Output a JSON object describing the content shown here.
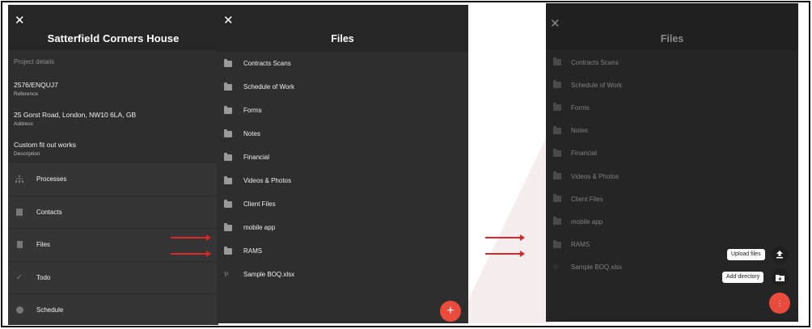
{
  "panel1": {
    "title": "Satterfield Corners House",
    "section_label": "Project details",
    "details": [
      {
        "value": "2576/ENQUJ7",
        "key": "Reference"
      },
      {
        "value": "25 Gorst Road, London, NW10 6LA, GB",
        "key": "Address"
      },
      {
        "value": "Custom fit out works",
        "key": "Description"
      }
    ],
    "menu": [
      {
        "label": "Processes",
        "icon": "sitemap-icon"
      },
      {
        "label": "Contacts",
        "icon": "contacts-icon"
      },
      {
        "label": "Files",
        "icon": "file-icon"
      },
      {
        "label": "Todo",
        "icon": "check-icon"
      },
      {
        "label": "Schedule",
        "icon": "clock-icon"
      }
    ]
  },
  "panel2": {
    "title": "Files",
    "items": [
      "Contracts Scans",
      "Schedule of Work",
      "Forms",
      "Notes",
      "Financial",
      "Videos & Photos",
      "Client Files",
      "mobile app",
      "RAMS",
      "Sample BOQ.xlsx"
    ],
    "fab_symbol": "+"
  },
  "panel3": {
    "title": "Files",
    "items": [
      "Contracts Scans",
      "Schedule of Work",
      "Forms",
      "Notes",
      "Financial",
      "Videos & Photos",
      "Client Files",
      "mobile app",
      "RAMS",
      "Sample BOQ.xlsx"
    ],
    "upload_label": "Upload files",
    "add_dir_label": "Add directory",
    "fab_symbol": "⋮"
  },
  "glyphs": {
    "close": "✕",
    "file": "⅌"
  },
  "colors": {
    "accent": "#e94b3c",
    "arrow": "#d9262b",
    "panel": "#2e2e2e"
  }
}
